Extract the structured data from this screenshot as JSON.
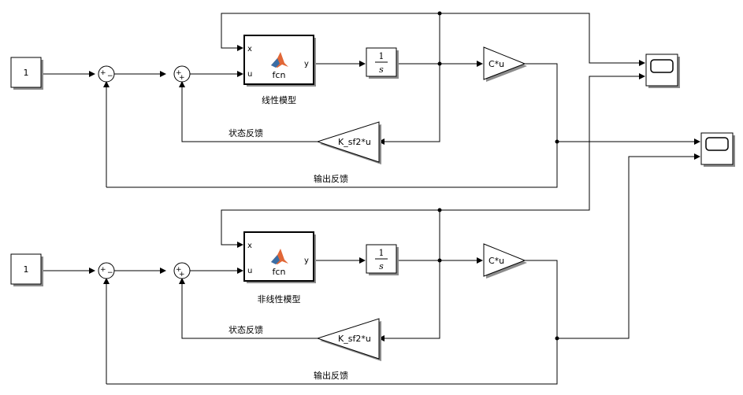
{
  "linear": {
    "constant_value": "1",
    "fcn_port_x": "x",
    "fcn_port_u": "u",
    "fcn_port_y": "y",
    "fcn_name": "fcn",
    "integrator_num": "1",
    "integrator_den": "s",
    "gain_c": "C*u",
    "gain_k": "K_sf2*u",
    "label_model": "线性模型",
    "label_state_fb": "状态反馈",
    "label_output_fb": "输出反馈",
    "sum1_sign_top": "+",
    "sum1_sign_bottom": "−",
    "sum2_sign_top": "+",
    "sum2_sign_bottom": "+"
  },
  "nonlinear": {
    "constant_value": "1",
    "fcn_port_x": "x",
    "fcn_port_u": "u",
    "fcn_port_y": "y",
    "fcn_name": "fcn",
    "integrator_num": "1",
    "integrator_den": "s",
    "gain_c": "C*u",
    "gain_k": "K_sf2*u",
    "label_model": "非线性模型",
    "label_state_fb": "状态反馈",
    "label_output_fb": "输出反馈",
    "sum1_sign_top": "+",
    "sum1_sign_bottom": "−",
    "sum2_sign_top": "+",
    "sum2_sign_bottom": "+"
  },
  "colors": {
    "line": "#000000",
    "block_fill": "#ffffff",
    "shadow": "#8c8c8c",
    "matlab_logo_orange": "#e16737",
    "matlab_logo_blue": "#3a6ea5"
  }
}
